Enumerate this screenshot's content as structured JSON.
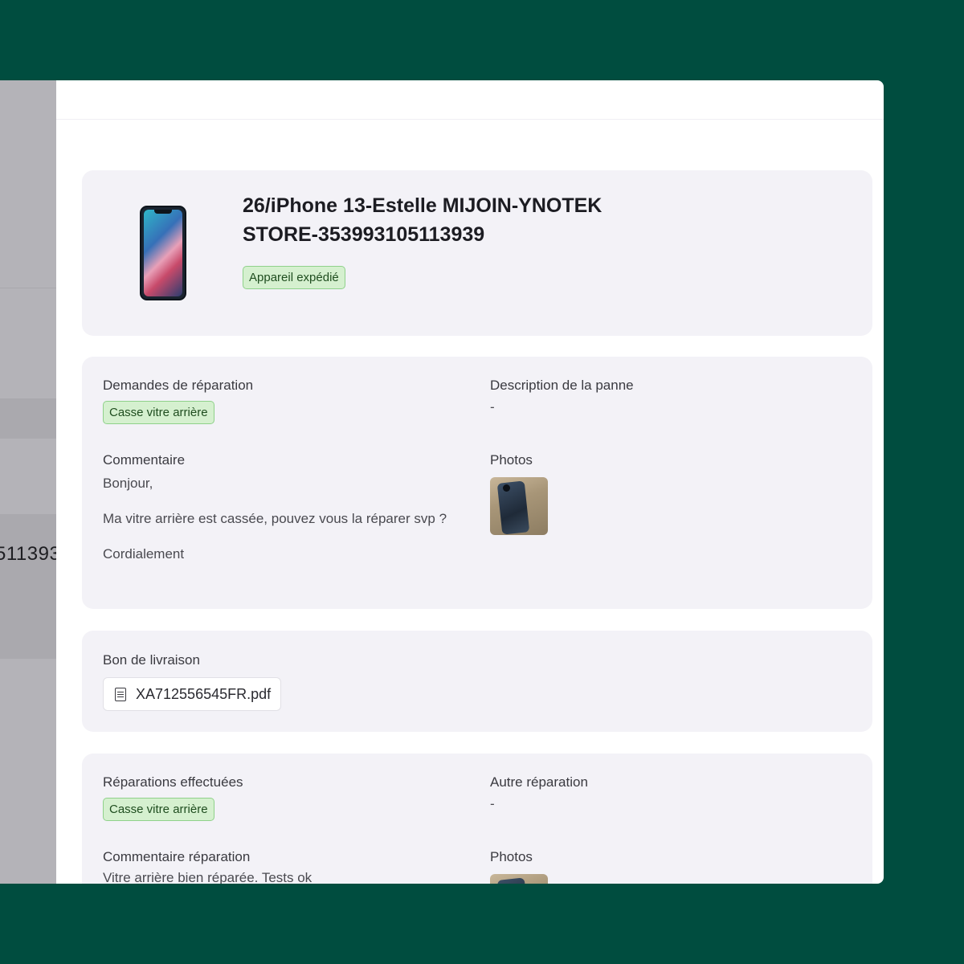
{
  "background_text": "511393",
  "device": {
    "title_line1": "26/iPhone 13-Estelle MIJOIN-YNOTEK",
    "title_line2": "STORE-353993105113939",
    "status_badge": "Appareil expédié"
  },
  "repair_request": {
    "requests_label": "Demandes de réparation",
    "requests_badge": "Casse vitre arrière",
    "description_label": "Description de la panne",
    "description_value": "-",
    "comment_label": "Commentaire",
    "comment_lines": [
      "Bonjour,",
      "Ma vitre arrière est cassée, pouvez vous la réparer svp ?",
      "Cordialement"
    ],
    "photos_label": "Photos"
  },
  "shipping": {
    "label": "Bon de livraison",
    "file_name": "XA712556545FR.pdf"
  },
  "repairs_done": {
    "label": "Réparations effectuées",
    "badge": "Casse vitre arrière",
    "other_label": "Autre réparation",
    "other_value": "-",
    "comment_label": "Commentaire réparation",
    "comment_value": "Vitre arrière bien réparée. Tests ok",
    "photos_label": "Photos"
  },
  "colors": {
    "page_background": "#004d3f",
    "badge_bg": "#d5f0cf",
    "badge_border": "#8fd18a",
    "card_bg": "#f3f2f7"
  }
}
